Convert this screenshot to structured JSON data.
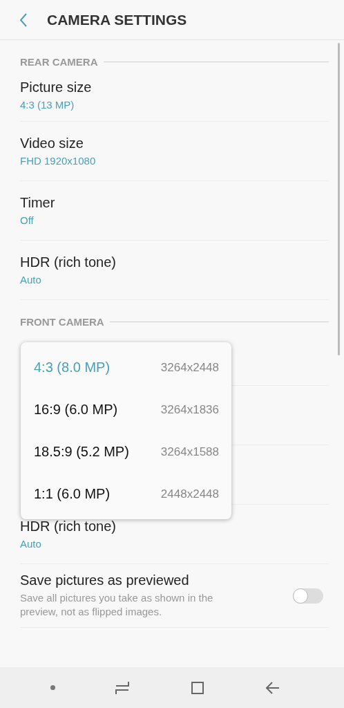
{
  "header": {
    "title": "CAMERA SETTINGS"
  },
  "sections": [
    {
      "title": "REAR CAMERA",
      "items": [
        {
          "kind": "value",
          "title": "Picture size",
          "value": "4:3 (13 MP)"
        },
        {
          "kind": "value",
          "title": "Video size",
          "value": "FHD 1920x1080"
        },
        {
          "kind": "value",
          "title": "Timer",
          "value": "Off"
        },
        {
          "kind": "value",
          "title": "HDR (rich tone)",
          "value": "Auto"
        }
      ]
    },
    {
      "title": "FRONT CAMERA",
      "popup": {
        "options": [
          {
            "label": "4:3 (8.0 MP)",
            "resolution": "3264x2448",
            "selected": true
          },
          {
            "label": "16:9 (6.0 MP)",
            "resolution": "3264x1836",
            "selected": false
          },
          {
            "label": "18.5:9 (5.2 MP)",
            "resolution": "3264x1588",
            "selected": false
          },
          {
            "label": "1:1 (6.0 MP)",
            "resolution": "2448x2448",
            "selected": false
          }
        ]
      },
      "items": [
        {
          "kind": "value",
          "title": "HDR (rich tone)",
          "value": "Auto"
        },
        {
          "kind": "switch",
          "title": "Save pictures as previewed",
          "summary": "Save all pictures you take as shown in the preview, not as flipped images.",
          "on": false
        }
      ]
    }
  ]
}
